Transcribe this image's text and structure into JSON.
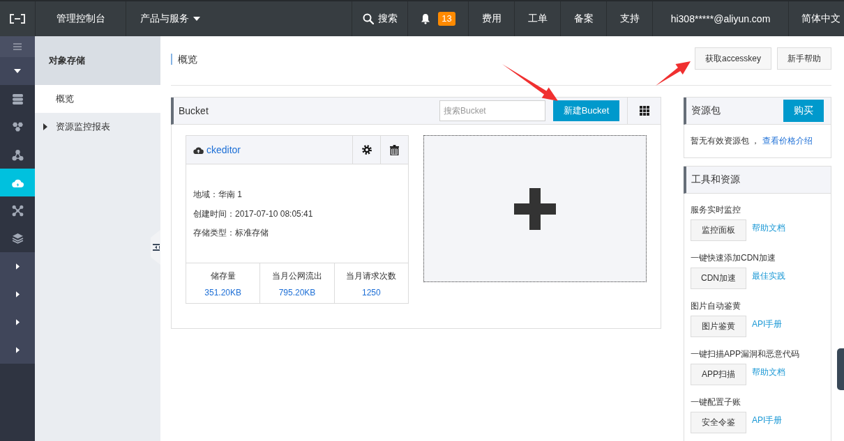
{
  "top_bar": {
    "console_label": "管理控制台",
    "products_menu": "产品与服务",
    "search": "搜索",
    "notification_count": "13",
    "nav_links": [
      "费用",
      "工单",
      "备案",
      "支持"
    ],
    "account": "hi308*****@aliyun.com",
    "language": "简体中文"
  },
  "icon_sidebar": {
    "groups": [
      {
        "expanded": true,
        "items": [
          {
            "selected": false
          },
          {
            "selected": false
          },
          {
            "selected": false
          },
          {
            "selected": true
          },
          {
            "selected": false
          },
          {
            "selected": false
          }
        ]
      },
      {
        "expanded": false
      },
      {
        "expanded": false
      },
      {
        "expanded": false
      },
      {
        "expanded": false
      }
    ]
  },
  "service_nav": {
    "title": "对象存储",
    "items": [
      {
        "kind": "link",
        "label": "概览",
        "selected": true
      },
      {
        "kind": "group",
        "label": "资源监控报表",
        "selected": false,
        "expanded": false
      }
    ]
  },
  "page": {
    "title": "概览",
    "buttons": [
      "获取accesskey",
      "新手帮助"
    ]
  },
  "bucket_panel": {
    "title": "Bucket",
    "search": {
      "placeholder": "搜索Bucket"
    },
    "create_button": "新建Bucket",
    "buckets": [
      {
        "name": "ckeditor",
        "details": [
          "地域：华南 1",
          "创建时间：2017-07-10 08:05:41",
          "存储类型：标准存储"
        ],
        "stats": [
          {
            "label": "储存量",
            "value": "351.20KB"
          },
          {
            "label": "当月公网流出",
            "value": "795.20KB"
          },
          {
            "label": "当月请求次数",
            "value": "1250"
          }
        ]
      }
    ]
  },
  "resource_pack": {
    "title": "资源包",
    "buy_button": "购买",
    "message": "暂无有效资源包 ，",
    "link": "查看价格介绍"
  },
  "tools": {
    "title": "工具和资源",
    "items": [
      {
        "description": "服务实时监控",
        "button": "监控面板",
        "link": "帮助文档"
      },
      {
        "description": "一键快速添加CDN加速",
        "button": "CDN加速",
        "link": "最佳实践"
      },
      {
        "description": "图片自动鉴黄",
        "button": "图片鉴黄",
        "link": "API手册"
      },
      {
        "description": "一键扫描APP漏洞和恶意代码",
        "button": "APP扫描",
        "link": "帮助文档"
      },
      {
        "description": "一键配置子账",
        "button": "安全令鉴",
        "link": "API手册"
      }
    ]
  }
}
